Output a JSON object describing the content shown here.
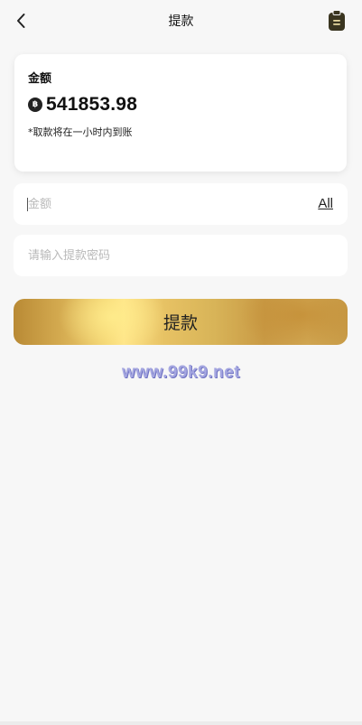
{
  "header": {
    "title": "提款",
    "back_icon": "chevron-left-icon",
    "records_icon": "clipboard-icon"
  },
  "balance_card": {
    "label": "金额",
    "currency_icon": "baht-coin-icon",
    "currency_symbol": "฿",
    "amount": "541853.98",
    "note": "*取款将在一小时内到账"
  },
  "amount_input": {
    "placeholder": "金额",
    "value": "",
    "all_label": "All"
  },
  "password_input": {
    "placeholder": "请输入提款密码",
    "value": ""
  },
  "submit": {
    "label": "提款"
  },
  "watermark": {
    "text": "www.99k9.net"
  },
  "colors": {
    "background": "#f7f7f7",
    "card": "#ffffff",
    "gold_light": "#ffe489",
    "gold_dark": "#b98a35",
    "watermark": "#a4a6e0",
    "icon_dark": "#3a3520"
  }
}
